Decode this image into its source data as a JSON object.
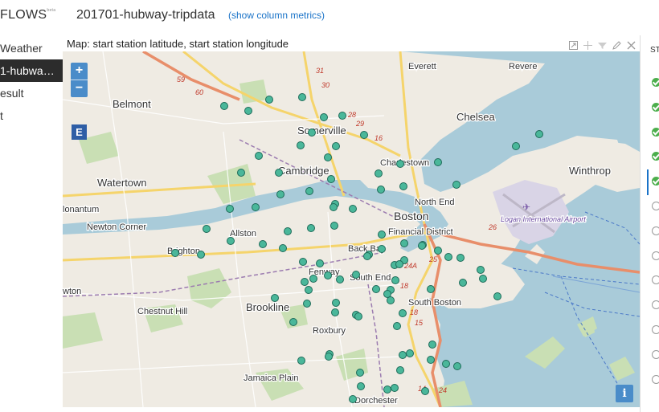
{
  "sidebar": {
    "brand": "FLOWS",
    "brand_sup": "beta",
    "items": [
      {
        "label": "Weather",
        "active": false
      },
      {
        "label": "1-hubwa…",
        "active": true
      },
      {
        "label": "esult",
        "active": false
      },
      {
        "label": "t",
        "active": false
      }
    ]
  },
  "header": {
    "title": "201701-hubway-tripdata",
    "link": "(show column metrics)"
  },
  "map": {
    "title": "Map: start station latitude, start station longitude",
    "zoom_in": "+",
    "zoom_out": "−",
    "export_label": "E",
    "info_label": "i",
    "places": [
      {
        "name": "Belmont"
      },
      {
        "name": "Somerville"
      },
      {
        "name": "Chelsea"
      },
      {
        "name": "Cambridge"
      },
      {
        "name": "Charlestown"
      },
      {
        "name": "Watertown"
      },
      {
        "name": "Winthrop"
      },
      {
        "name": "North End"
      },
      {
        "name": "Newton Corner"
      },
      {
        "name": "Allston"
      },
      {
        "name": "Boston"
      },
      {
        "name": "Financial District"
      },
      {
        "name": "Logan International Airport"
      },
      {
        "name": "Brighton"
      },
      {
        "name": "Back Bay"
      },
      {
        "name": "Fenway"
      },
      {
        "name": "South End"
      },
      {
        "name": "South Boston"
      },
      {
        "name": "Chestnut Hill"
      },
      {
        "name": "Brookline"
      },
      {
        "name": "Roxbury"
      },
      {
        "name": "Jamaica Plain"
      },
      {
        "name": "Dorchester"
      },
      {
        "name": "Everett"
      },
      {
        "name": "Revere"
      },
      {
        "name": "lonantum"
      },
      {
        "name": "wton"
      }
    ],
    "route_labels": [
      "59",
      "60",
      "31",
      "30",
      "28",
      "29",
      "16",
      "26",
      "24A",
      "25",
      "18",
      "18",
      "15",
      "14",
      "24"
    ]
  },
  "steps_panel": {
    "title": "ST",
    "steps": [
      "done",
      "done",
      "done",
      "done",
      "done",
      "todo",
      "todo",
      "todo",
      "todo",
      "todo",
      "todo",
      "todo",
      "todo"
    ]
  },
  "colors": {
    "accent": "#1a73c8",
    "station_marker": "#4ab79a",
    "water": "#a9cbd9",
    "land": "#efebe3",
    "park": "#c9dfb4"
  }
}
